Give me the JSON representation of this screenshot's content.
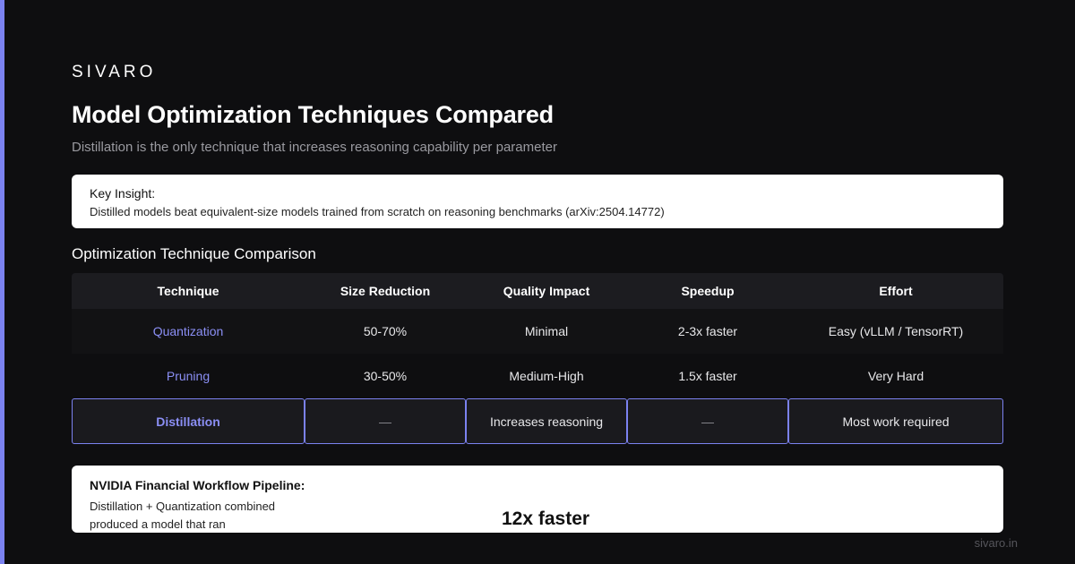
{
  "brand": "SIVARO",
  "title": "Model Optimization Techniques Compared",
  "subtitle": "Distillation is the only technique that increases reasoning capability per parameter",
  "insight": {
    "label": "Key Insight:",
    "text": "Distilled models beat equivalent-size models trained from scratch on reasoning benchmarks (arXiv:2504.14772)"
  },
  "section_title": "Optimization Technique Comparison",
  "table": {
    "headers": [
      "Technique",
      "Size Reduction",
      "Quality Impact",
      "Speedup",
      "Effort"
    ],
    "rows": [
      [
        "Quantization",
        "50-70%",
        "Minimal",
        "2-3x faster",
        "Easy (vLLM / TensorRT)"
      ],
      [
        "Pruning",
        "30-50%",
        "Medium-High",
        "1.5x faster",
        "Very Hard"
      ],
      [
        "Distillation",
        "—",
        "Increases reasoning",
        "—",
        "Most work required"
      ]
    ],
    "highlighted_row": "Distillation"
  },
  "pipeline": {
    "label": "NVIDIA Financial Workflow Pipeline:",
    "text": "Distillation + Quantization combined produced a model that ran",
    "big_text": "12x faster"
  },
  "footer": "sivaro.in",
  "colors": {
    "background": "#0e0e10",
    "accent": "#7b82f0",
    "technique_text": "#8b8ff5",
    "card": "#ffffff"
  }
}
